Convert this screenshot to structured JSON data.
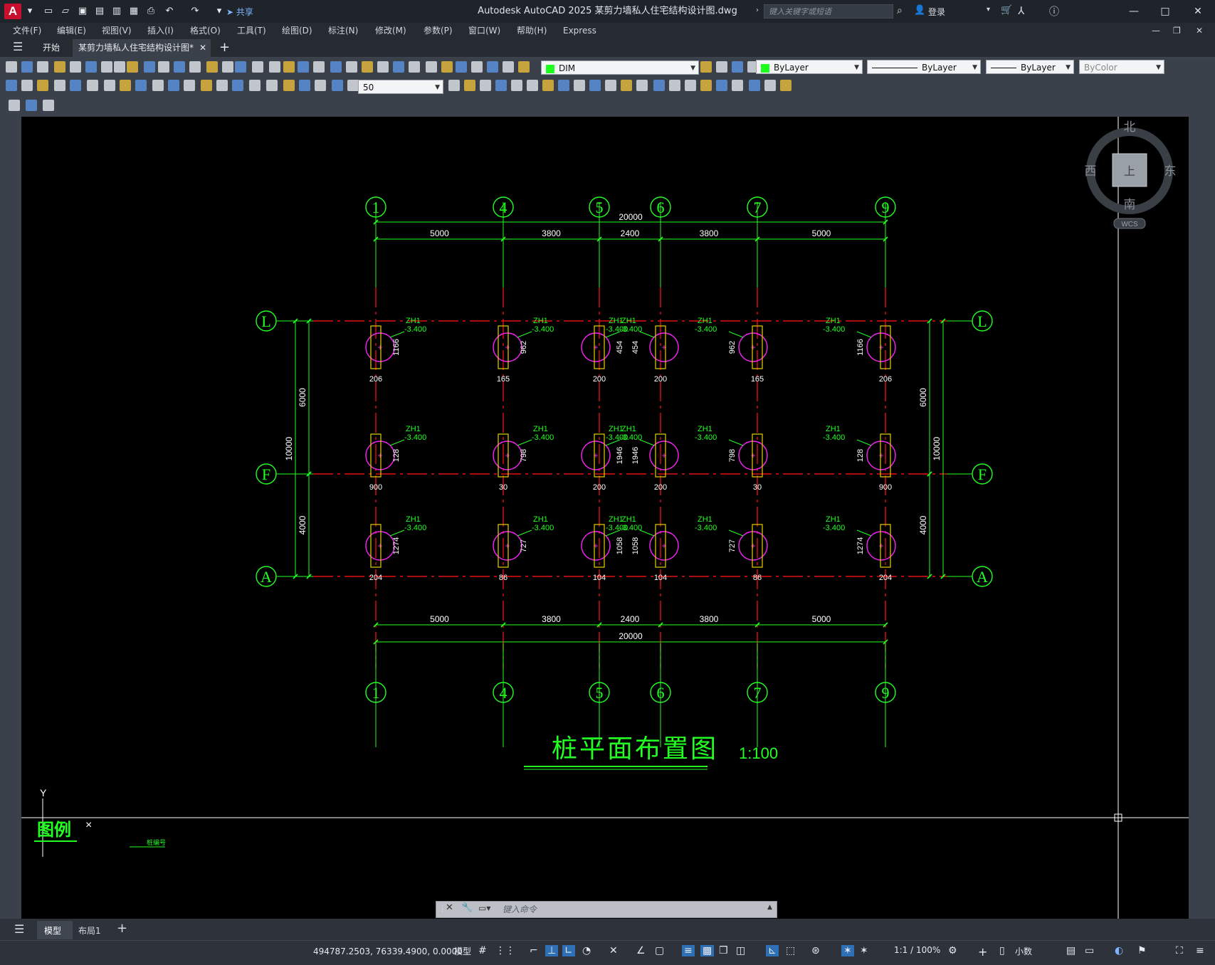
{
  "app": {
    "title": "Autodesk AutoCAD 2025    某剪力墙私人住宅结构设计图.dwg",
    "logo": "A",
    "share": "共享",
    "search_placeholder": "键入关键字或短语",
    "login": "登录"
  },
  "menus": [
    "文件(F)",
    "编辑(E)",
    "视图(V)",
    "插入(I)",
    "格式(O)",
    "工具(T)",
    "绘图(D)",
    "标注(N)",
    "修改(M)",
    "参数(P)",
    "窗口(W)",
    "帮助(H)",
    "Express"
  ],
  "tabs": {
    "start": "开始",
    "active": "某剪力墙私人住宅结构设计图*"
  },
  "toolbar": {
    "layer": "DIM",
    "scale": "50",
    "color": "ByLayer",
    "linetype": "ByLayer",
    "lineweight": "ByLayer",
    "plotstyle": "ByColor"
  },
  "viewcube": {
    "north": "北",
    "south": "南",
    "east": "东",
    "west": "西",
    "top": "上",
    "wcs": "WCS"
  },
  "drawing": {
    "title": "桩平面布置图",
    "scale": "1:100",
    "legend": "图例",
    "legend_note": "桩编号",
    "ucs_y": "Y",
    "grid_cols": [
      "1",
      "4",
      "5",
      "6",
      "7",
      "9"
    ],
    "grid_rows": [
      "L",
      "F",
      "A"
    ],
    "top_total": "20000",
    "bottom_total": "20000",
    "col_spacings": [
      "5000",
      "3800",
      "2400",
      "3800",
      "5000"
    ],
    "side_dims": {
      "left_upper": "6000",
      "left_lower": "4000",
      "left_total": "10000",
      "right_upper": "6000",
      "right_lower": "4000",
      "right_total": "10000"
    },
    "pile_label": "ZH1",
    "pile_level": "-3.400",
    "piles": [
      {
        "col": 0,
        "row": "L",
        "dim": "1166",
        "bottom": "206"
      },
      {
        "col": 1,
        "row": "L",
        "dim": "962",
        "bottom": "165"
      },
      {
        "col": 2,
        "row": "L",
        "dim": "454",
        "bottom": "200"
      },
      {
        "col": 3,
        "row": "L",
        "dim": "454",
        "bottom": "200"
      },
      {
        "col": 4,
        "row": "L",
        "dim": "962",
        "bottom": "165"
      },
      {
        "col": 5,
        "row": "L",
        "dim": "1166",
        "bottom": "206"
      },
      {
        "col": 0,
        "row": "F",
        "dim": "128",
        "bottom": "900"
      },
      {
        "col": 1,
        "row": "F",
        "dim": "798",
        "bottom": "30"
      },
      {
        "col": 2,
        "row": "F",
        "dim": "1946",
        "bottom": "200"
      },
      {
        "col": 3,
        "row": "F",
        "dim": "1946",
        "bottom": "200"
      },
      {
        "col": 4,
        "row": "F",
        "dim": "798",
        "bottom": "30"
      },
      {
        "col": 5,
        "row": "F",
        "dim": "128",
        "bottom": "900"
      },
      {
        "col": 0,
        "row": "A",
        "dim": "1274",
        "bottom": "204"
      },
      {
        "col": 1,
        "row": "A",
        "dim": "727",
        "bottom": "86"
      },
      {
        "col": 2,
        "row": "A",
        "dim": "1058",
        "bottom": "104"
      },
      {
        "col": 3,
        "row": "A",
        "dim": "1058",
        "bottom": "104"
      },
      {
        "col": 4,
        "row": "A",
        "dim": "727",
        "bottom": "86"
      },
      {
        "col": 5,
        "row": "A",
        "dim": "1274",
        "bottom": "204"
      }
    ]
  },
  "command": {
    "placeholder": "键入命令"
  },
  "layout_tabs": [
    "模型",
    "布局1"
  ],
  "status": {
    "coords": "494787.2503, 76339.4900, 0.0000",
    "mode": "模型",
    "scale": "1:1 / 100%",
    "units": "小数"
  }
}
